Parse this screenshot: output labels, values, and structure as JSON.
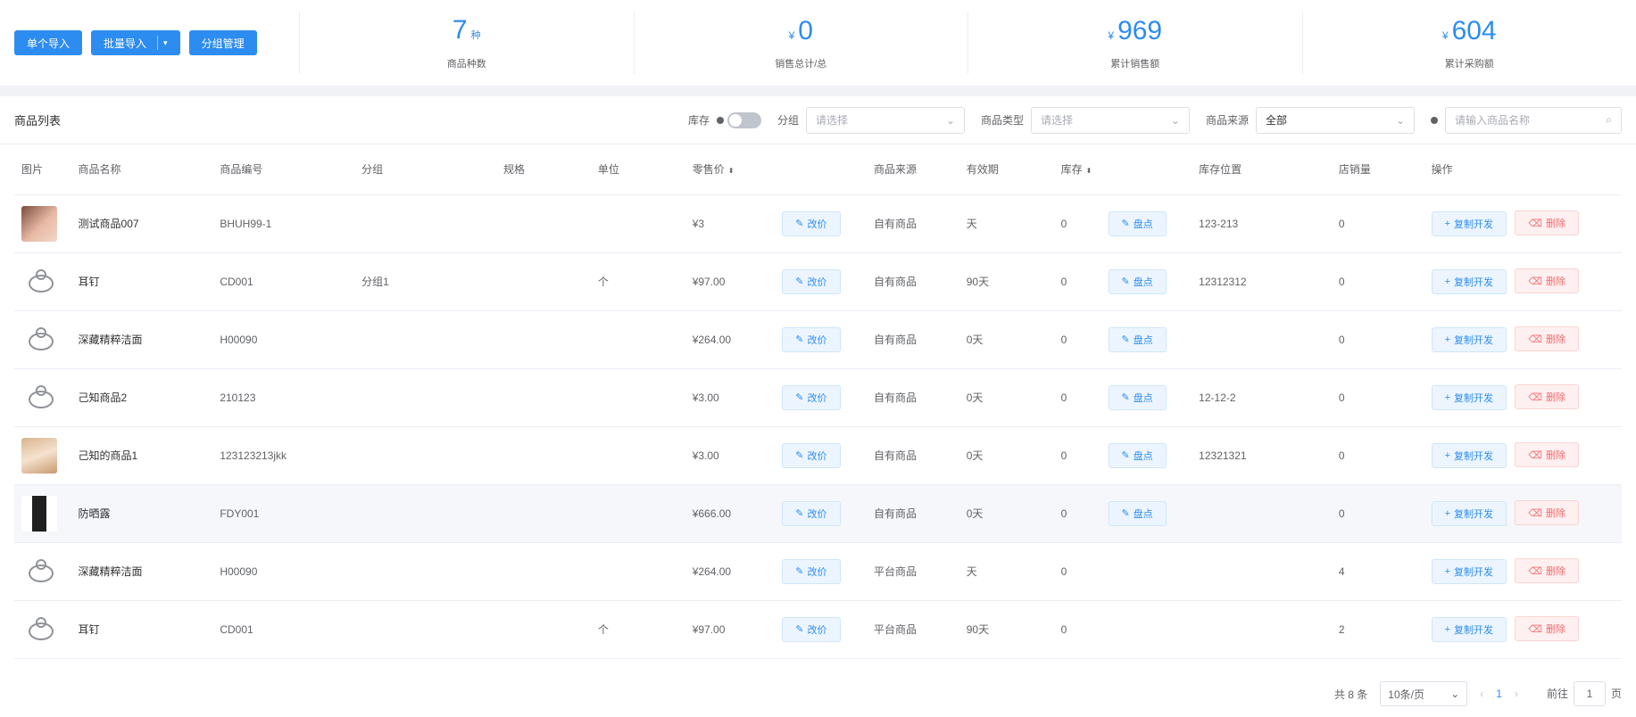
{
  "toolbar": {
    "btn1": "单个导入",
    "btn2": "批量导入",
    "btn3": "分组管理"
  },
  "stats": [
    {
      "value": "7",
      "unit": "种",
      "prefix": "",
      "label": "商品种数"
    },
    {
      "value": "0",
      "unit": "",
      "prefix": "¥",
      "label": "销售总计/总"
    },
    {
      "value": "969",
      "unit": "",
      "prefix": "¥",
      "label": "累计销售额"
    },
    {
      "value": "604",
      "unit": "",
      "prefix": "¥",
      "label": "累计采购额"
    }
  ],
  "list": {
    "title": "商品列表",
    "stock_label": "库存",
    "group_label": "分组",
    "group_placeholder": "请选择",
    "type_label": "商品类型",
    "type_placeholder": "请选择",
    "source_label": "商品来源",
    "source_value": "全部",
    "search_placeholder": "请输入商品名称"
  },
  "columns": [
    "图片",
    "商品名称",
    "商品编号",
    "分组",
    "规格",
    "单位",
    "零售价",
    "",
    "商品来源",
    "有效期",
    "库存",
    "",
    "库存位置",
    "店销量",
    "操作"
  ],
  "actions": {
    "price": "改价",
    "stock": "盘点",
    "copy": "复制开发",
    "delete": "删除"
  },
  "rows": [
    {
      "thumb": "photo1",
      "name": "测试商品007",
      "code": "BHUH99-1",
      "group": "",
      "spec": "",
      "unit": "",
      "price": "¥3",
      "source": "自有商品",
      "validity": "天",
      "stock": "0",
      "stock_btn": true,
      "location": "123-213",
      "sales": "0"
    },
    {
      "thumb": "placeholder",
      "name": "耳钉",
      "code": "CD001",
      "group": "分组1",
      "spec": "",
      "unit": "个",
      "price": "¥97.00",
      "source": "自有商品",
      "validity": "90天",
      "stock": "0",
      "stock_btn": true,
      "location": "12312312",
      "sales": "0"
    },
    {
      "thumb": "placeholder",
      "name": "深藏精粹洁面",
      "code": "H00090",
      "group": "",
      "spec": "",
      "unit": "",
      "price": "¥264.00",
      "source": "自有商品",
      "validity": "0天",
      "stock": "0",
      "stock_btn": true,
      "location": "",
      "sales": "0"
    },
    {
      "thumb": "placeholder",
      "name": "己知商品2",
      "code": "210123",
      "group": "",
      "spec": "",
      "unit": "",
      "price": "¥3.00",
      "source": "自有商品",
      "validity": "0天",
      "stock": "0",
      "stock_btn": true,
      "location": "12-12-2",
      "sales": "0"
    },
    {
      "thumb": "photo2",
      "name": "己知的商品1",
      "code": "123123213jkk",
      "group": "",
      "spec": "",
      "unit": "",
      "price": "¥3.00",
      "source": "自有商品",
      "validity": "0天",
      "stock": "0",
      "stock_btn": true,
      "location": "12321321",
      "sales": "0"
    },
    {
      "thumb": "bottle",
      "name": "防晒露",
      "code": "FDY001",
      "group": "",
      "spec": "",
      "unit": "",
      "price": "¥666.00",
      "source": "自有商品",
      "validity": "0天",
      "stock": "0",
      "stock_btn": true,
      "location": "",
      "sales": "0",
      "highlight": true
    },
    {
      "thumb": "placeholder",
      "name": "深藏精粹洁面",
      "code": "H00090",
      "group": "",
      "spec": "",
      "unit": "",
      "price": "¥264.00",
      "source": "平台商品",
      "validity": "天",
      "stock": "0",
      "stock_btn": false,
      "location": "",
      "sales": "4"
    },
    {
      "thumb": "placeholder",
      "name": "耳钉",
      "code": "CD001",
      "group": "",
      "spec": "",
      "unit": "个",
      "price": "¥97.00",
      "source": "平台商品",
      "validity": "90天",
      "stock": "0",
      "stock_btn": false,
      "location": "",
      "sales": "2"
    }
  ],
  "pagination": {
    "total": "共 8 条",
    "page_size": "10条/页",
    "current": "1",
    "goto_label": "前往",
    "goto_value": "1",
    "goto_suffix": "页"
  },
  "colors": {
    "accent": "#2d8cf0",
    "danger": "#f56c6c"
  }
}
